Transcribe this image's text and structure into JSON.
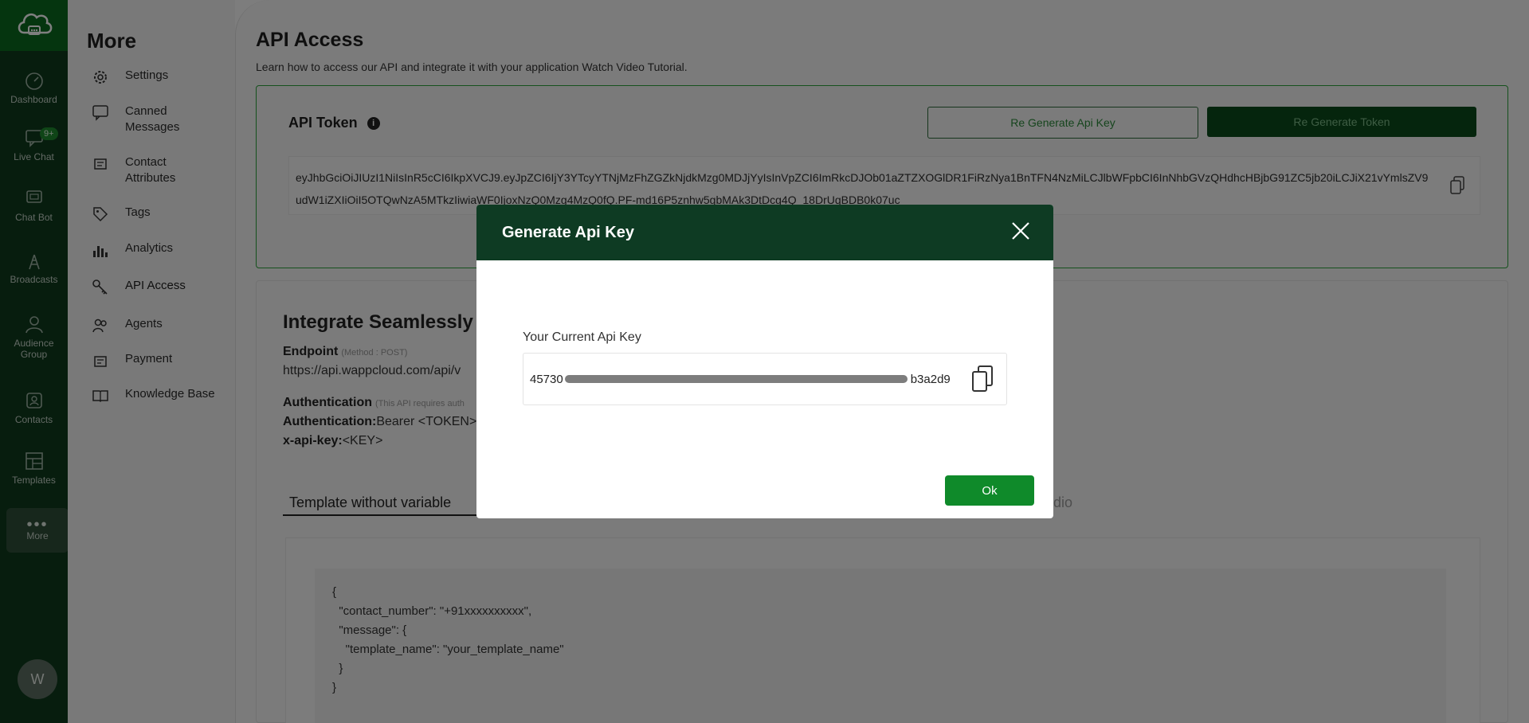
{
  "rail": {
    "items": [
      {
        "label": "Dashboard"
      },
      {
        "label": "Live Chat",
        "badge": "9+"
      },
      {
        "label": "Chat Bot"
      },
      {
        "label": "Broadcasts"
      },
      {
        "label": "Audience Group"
      },
      {
        "label": "Contacts"
      },
      {
        "label": "Templates"
      },
      {
        "label": "More"
      }
    ],
    "avatar": "W"
  },
  "sidebar": {
    "title": "More",
    "items": [
      {
        "label": "Settings"
      },
      {
        "label": "Canned Messages"
      },
      {
        "label": "Contact Attributes"
      },
      {
        "label": "Tags"
      },
      {
        "label": "Analytics"
      },
      {
        "label": "API Access"
      },
      {
        "label": "Agents"
      },
      {
        "label": "Payment"
      },
      {
        "label": "Knowledge Base"
      }
    ]
  },
  "page": {
    "title": "API Access",
    "subtitle": "Learn how to access our API and integrate it with your application Watch Video Tutorial."
  },
  "token_card": {
    "label": "API Token",
    "regen_key_label": "Re Generate Api Key",
    "regen_token_label": "Re Generate Token",
    "token": "eyJhbGciOiJIUzI1NiIsInR5cCI6IkpXVCJ9.eyJpZCI6IjY3YTcyYTNjMzFhZGZkNjdkMzg0MDJjYyIsInVpZCI6ImRkcDJOb01aZTZXOGlDR1FiRzNya1BnTFN4NzMiLCJlbWFpbCI6InNhbGVzQHdhcHBjbG91ZC5jb20iLCJiX21vYmlsZV9udW1iZXIiOiI5OTQwNzA5MTkzIiwiaWF0IjoxNzQ0Mzg4MzQ0fQ.PF-md16P5znhw5gbMAk3DtDcg4Q_18DrUqBDB0k07uc"
  },
  "integrate": {
    "title": "Integrate Seamlessly",
    "endpoint_label": "Endpoint",
    "endpoint_method": "(Method : POST)",
    "endpoint_url": "https://api.wappcloud.com/api/v",
    "auth_label": "Authentication",
    "auth_note": "(This API requires auth",
    "auth_key": "Authentication:",
    "auth_value": "Bearer <TOKEN>",
    "api_key_label": "x-api-key:",
    "api_key_value": "<KEY>",
    "tab_active": "Template without variable",
    "tab_other": "dio",
    "code": "{\n  \"contact_number\": \"+91xxxxxxxxxx\",\n  \"message\": {\n    \"template_name\": \"your_template_name\"\n  }\n}"
  },
  "modal": {
    "title": "Generate Api Key",
    "field_label": "Your Current Api Key",
    "key_prefix": "45730",
    "key_suffix": "b3a2d9",
    "ok_label": "Ok"
  },
  "colors": {
    "rail_bg": "#0e3b1d",
    "brand_green": "#0f8a2a",
    "modal_header": "#0e3b23"
  }
}
